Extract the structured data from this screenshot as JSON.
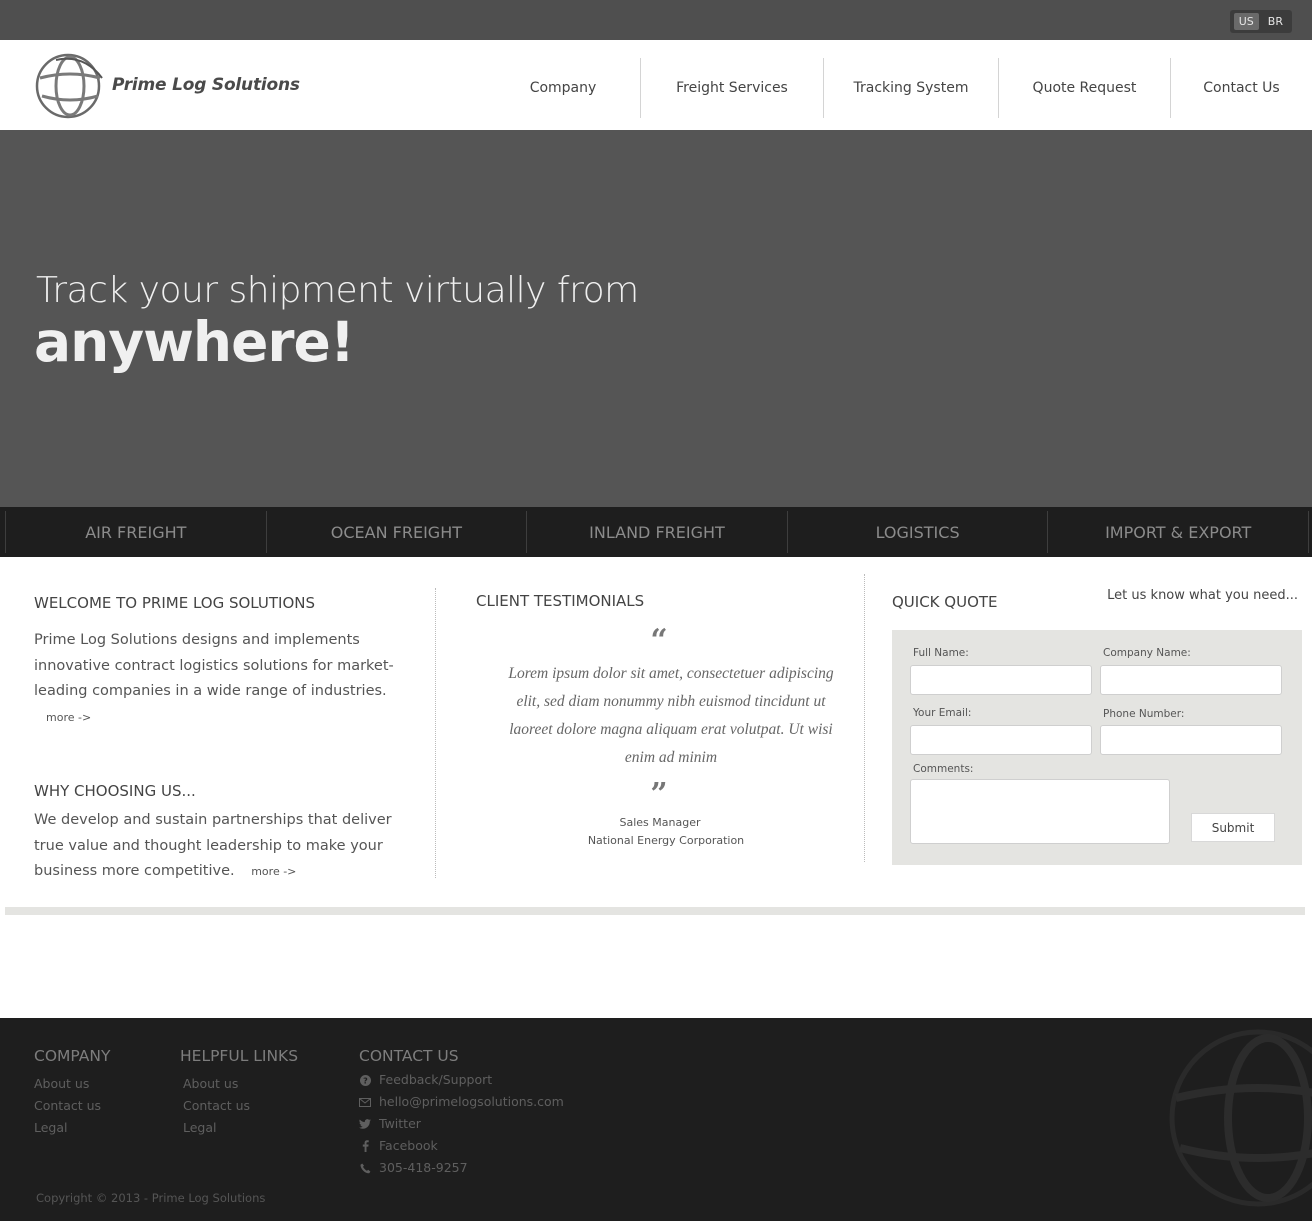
{
  "topbar": {
    "languages": [
      {
        "code": "US",
        "active": true
      },
      {
        "code": "BR",
        "active": false
      }
    ]
  },
  "header": {
    "logo_text": "Prime Log Solutions",
    "nav": [
      "Company",
      "Freight Services",
      "Tracking System",
      "Quote Request",
      "Contact Us"
    ]
  },
  "hero": {
    "line1": "Track your shipment virtually from",
    "line2": "anywhere!"
  },
  "services": [
    "AIR FREIGHT",
    "OCEAN FREIGHT",
    "INLAND FREIGHT",
    "LOGISTICS",
    "IMPORT & EXPORT"
  ],
  "welcome": {
    "title": "WELCOME TO PRIME LOG SOLUTIONS",
    "text": "Prime Log Solutions designs and implements innovative contract logistics solutions for market-leading companies in a wide range of industries.",
    "more": "more ->"
  },
  "why": {
    "title": "WHY CHOOSING US...",
    "text": "We develop and sustain partnerships that deliver true value and thought leadership to make your business more competitive.",
    "more": "more ->"
  },
  "testimonials": {
    "title": "CLIENT TESTIMONIALS",
    "open_quote": "“",
    "close_quote": "”",
    "text": "Lorem ipsum dolor sit amet, consectetuer adipiscing elit, sed diam nonummy nibh euismod tincidunt ut laoreet dolore magna aliquam erat volutpat. Ut wisi enim ad minim",
    "author_role": "Sales Manager",
    "author_company": "National Energy Corporation"
  },
  "quick_quote": {
    "title": "QUICK QUOTE",
    "subtitle": "Let us know what you need...",
    "labels": {
      "full_name": "Full Name:",
      "company_name": "Company Name:",
      "email": "Your Email:",
      "phone": "Phone Number:",
      "comments": "Comments:"
    },
    "values": {
      "full_name": "",
      "company_name": "",
      "email": "",
      "phone": "",
      "comments": ""
    },
    "submit": "Submit"
  },
  "footer": {
    "company": {
      "title": "COMPANY",
      "links": [
        "About us",
        "Contact us",
        "Legal"
      ]
    },
    "helpful": {
      "title": "HELPFUL LINKS",
      "links": [
        "About us",
        "Contact us",
        "Legal"
      ]
    },
    "contact": {
      "title": "CONTACT US",
      "items": [
        {
          "icon": "question-circle-icon",
          "text": "Feedback/Support"
        },
        {
          "icon": "envelope-icon",
          "text": "hello@primelogsolutions.com"
        },
        {
          "icon": "twitter-icon",
          "text": "Twitter"
        },
        {
          "icon": "facebook-icon",
          "text": "Facebook"
        },
        {
          "icon": "phone-icon",
          "text": "305-418-9257"
        }
      ]
    },
    "copyright": "Copyright © 2013 - Prime Log Solutions"
  },
  "colors": {
    "topbar": "#4f4f4f",
    "hero": "#555555",
    "services_bar": "#1e1e1e",
    "form_bg": "#e4e4e1",
    "footer": "#1e1e1e"
  }
}
